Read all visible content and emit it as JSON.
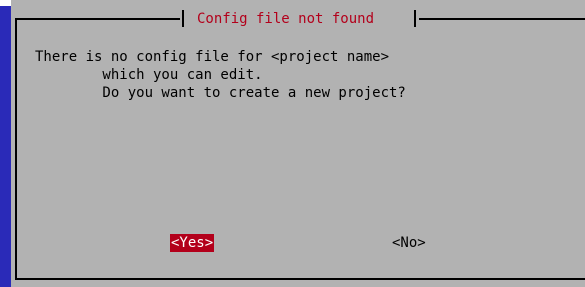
{
  "dialog": {
    "title": "Config file not found",
    "message_lines": [
      "There is no config file for <project name>",
      "        which you can edit.",
      "        Do you want to create a new project?"
    ]
  },
  "buttons": {
    "yes_label": "<Yes>",
    "no_label": "<No>",
    "selected": "<Yes>"
  },
  "colors": {
    "dialog_background": "#b2b2b2",
    "title_text": "#b3001b",
    "selected_button_background": "#b3001b",
    "screen_background": "#2a2ab8"
  }
}
